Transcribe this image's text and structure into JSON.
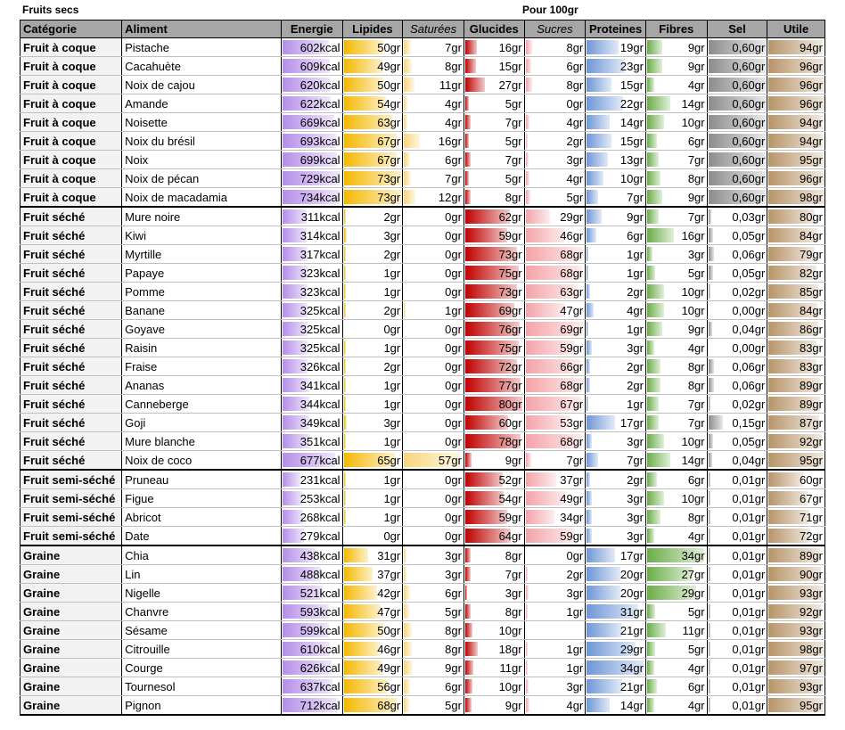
{
  "title": "Fruits secs",
  "subtitle": "Pour 100gr",
  "headers": [
    {
      "label": "Catégorie",
      "italic": false,
      "align": "left"
    },
    {
      "label": "Aliment",
      "italic": false,
      "align": "left"
    },
    {
      "label": "Energie",
      "italic": false,
      "align": "center"
    },
    {
      "label": "Lipides",
      "italic": false,
      "align": "center"
    },
    {
      "label": "Saturées",
      "italic": true,
      "align": "center"
    },
    {
      "label": "Glucides",
      "italic": false,
      "align": "center"
    },
    {
      "label": "Sucres",
      "italic": true,
      "align": "center"
    },
    {
      "label": "Proteines",
      "italic": false,
      "align": "center"
    },
    {
      "label": "Fibres",
      "italic": false,
      "align": "center"
    },
    {
      "label": "Sel",
      "italic": false,
      "align": "center"
    },
    {
      "label": "Utile",
      "italic": false,
      "align": "center"
    }
  ],
  "bar_colors": [
    "#b48ee9",
    "#f5b800",
    "#f8d678",
    "#c00000",
    "#f4a3a8",
    "#6e96d6",
    "#6aad47",
    "#8c8c8c",
    "#b79469"
  ],
  "bar_max": [
    734,
    73,
    57,
    80,
    69,
    34,
    34,
    0.6,
    98
  ],
  "rows": [
    [
      "Fruit à coque",
      "Pistache",
      "602kcal",
      "50gr",
      "7gr",
      "16gr",
      "8gr",
      "19gr",
      "9gr",
      "0,60gr",
      "94gr"
    ],
    [
      "Fruit à coque",
      "Cacahuète",
      "609kcal",
      "49gr",
      "8gr",
      "15gr",
      "6gr",
      "23gr",
      "9gr",
      "0,60gr",
      "96gr"
    ],
    [
      "Fruit à coque",
      "Noix de cajou",
      "620kcal",
      "50gr",
      "11gr",
      "27gr",
      "8gr",
      "15gr",
      "4gr",
      "0,60gr",
      "96gr"
    ],
    [
      "Fruit à coque",
      "Amande",
      "622kcal",
      "54gr",
      "4gr",
      "5gr",
      "0gr",
      "22gr",
      "14gr",
      "0,60gr",
      "96gr"
    ],
    [
      "Fruit à coque",
      "Noisette",
      "669kcal",
      "63gr",
      "4gr",
      "7gr",
      "4gr",
      "14gr",
      "10gr",
      "0,60gr",
      "94gr"
    ],
    [
      "Fruit à coque",
      "Noix du brésil",
      "693kcal",
      "67gr",
      "16gr",
      "5gr",
      "2gr",
      "15gr",
      "6gr",
      "0,60gr",
      "94gr"
    ],
    [
      "Fruit à coque",
      "Noix",
      "699kcal",
      "67gr",
      "6gr",
      "7gr",
      "3gr",
      "13gr",
      "7gr",
      "0,60gr",
      "95gr"
    ],
    [
      "Fruit à coque",
      "Noix de pécan",
      "729kcal",
      "73gr",
      "7gr",
      "5gr",
      "4gr",
      "10gr",
      "8gr",
      "0,60gr",
      "96gr"
    ],
    [
      "Fruit à coque",
      "Noix de macadamia",
      "734kcal",
      "73gr",
      "12gr",
      "8gr",
      "5gr",
      "7gr",
      "9gr",
      "0,60gr",
      "98gr"
    ],
    [
      "Fruit séché",
      "Mure noire",
      "311kcal",
      "2gr",
      "0gr",
      "62gr",
      "29gr",
      "9gr",
      "7gr",
      "0,03gr",
      "80gr"
    ],
    [
      "Fruit séché",
      "Kiwi",
      "314kcal",
      "3gr",
      "0gr",
      "59gr",
      "46gr",
      "6gr",
      "16gr",
      "0,05gr",
      "84gr"
    ],
    [
      "Fruit séché",
      "Myrtille",
      "317kcal",
      "2gr",
      "0gr",
      "73gr",
      "68gr",
      "1gr",
      "3gr",
      "0,06gr",
      "79gr"
    ],
    [
      "Fruit séché",
      "Papaye",
      "323kcal",
      "1gr",
      "0gr",
      "75gr",
      "68gr",
      "1gr",
      "5gr",
      "0,05gr",
      "82gr"
    ],
    [
      "Fruit séché",
      "Pomme",
      "323kcal",
      "1gr",
      "0gr",
      "73gr",
      "63gr",
      "2gr",
      "10gr",
      "0,02gr",
      "85gr"
    ],
    [
      "Fruit séché",
      "Banane",
      "325kcal",
      "2gr",
      "1gr",
      "69gr",
      "47gr",
      "4gr",
      "10gr",
      "0,00gr",
      "84gr"
    ],
    [
      "Fruit séché",
      "Goyave",
      "325kcal",
      "0gr",
      "0gr",
      "76gr",
      "69gr",
      "1gr",
      "9gr",
      "0,04gr",
      "86gr"
    ],
    [
      "Fruit séché",
      "Raisin",
      "325kcal",
      "1gr",
      "0gr",
      "75gr",
      "59gr",
      "3gr",
      "4gr",
      "0,00gr",
      "83gr"
    ],
    [
      "Fruit séché",
      "Fraise",
      "326kcal",
      "2gr",
      "0gr",
      "72gr",
      "66gr",
      "2gr",
      "8gr",
      "0,06gr",
      "83gr"
    ],
    [
      "Fruit séché",
      "Ananas",
      "341kcal",
      "1gr",
      "0gr",
      "77gr",
      "68gr",
      "2gr",
      "8gr",
      "0,06gr",
      "89gr"
    ],
    [
      "Fruit séché",
      "Canneberge",
      "344kcal",
      "1gr",
      "0gr",
      "80gr",
      "67gr",
      "1gr",
      "7gr",
      "0,02gr",
      "89gr"
    ],
    [
      "Fruit séché",
      "Goji",
      "349kcal",
      "3gr",
      "0gr",
      "60gr",
      "53gr",
      "17gr",
      "7gr",
      "0,15gr",
      "87gr"
    ],
    [
      "Fruit séché",
      "Mure blanche",
      "351kcal",
      "1gr",
      "0gr",
      "78gr",
      "68gr",
      "3gr",
      "10gr",
      "0,05gr",
      "92gr"
    ],
    [
      "Fruit séché",
      "Noix de coco",
      "677kcal",
      "65gr",
      "57gr",
      "9gr",
      "7gr",
      "7gr",
      "14gr",
      "0,04gr",
      "95gr"
    ],
    [
      "Fruit semi-séché",
      "Pruneau",
      "231kcal",
      "1gr",
      "0gr",
      "52gr",
      "37gr",
      "2gr",
      "6gr",
      "0,01gr",
      "60gr"
    ],
    [
      "Fruit semi-séché",
      "Figue",
      "253kcal",
      "1gr",
      "0gr",
      "54gr",
      "49gr",
      "3gr",
      "10gr",
      "0,01gr",
      "67gr"
    ],
    [
      "Fruit semi-séché",
      "Abricot",
      "268kcal",
      "1gr",
      "0gr",
      "59gr",
      "34gr",
      "3gr",
      "8gr",
      "0,01gr",
      "71gr"
    ],
    [
      "Fruit semi-séché",
      "Date",
      "279kcal",
      "0gr",
      "0gr",
      "64gr",
      "59gr",
      "3gr",
      "4gr",
      "0,01gr",
      "72gr"
    ],
    [
      "Graine",
      "Chia",
      "438kcal",
      "31gr",
      "3gr",
      "8gr",
      "0gr",
      "17gr",
      "34gr",
      "0,01gr",
      "89gr"
    ],
    [
      "Graine",
      "Lin",
      "488kcal",
      "37gr",
      "3gr",
      "7gr",
      "2gr",
      "20gr",
      "27gr",
      "0,01gr",
      "90gr"
    ],
    [
      "Graine",
      "Nigelle",
      "521kcal",
      "42gr",
      "6gr",
      "3gr",
      "3gr",
      "20gr",
      "29gr",
      "0,01gr",
      "93gr"
    ],
    [
      "Graine",
      "Chanvre",
      "593kcal",
      "47gr",
      "5gr",
      "8gr",
      "1gr",
      "31gr",
      "5gr",
      "0,01gr",
      "92gr"
    ],
    [
      "Graine",
      "Sésame",
      "599kcal",
      "50gr",
      "8gr",
      "10gr",
      "",
      "21gr",
      "11gr",
      "0,01gr",
      "93gr"
    ],
    [
      "Graine",
      "Citrouille",
      "610kcal",
      "46gr",
      "8gr",
      "18gr",
      "1gr",
      "29gr",
      "5gr",
      "0,01gr",
      "98gr"
    ],
    [
      "Graine",
      "Courge",
      "626kcal",
      "49gr",
      "9gr",
      "11gr",
      "1gr",
      "34gr",
      "4gr",
      "0,01gr",
      "97gr"
    ],
    [
      "Graine",
      "Tournesol",
      "637kcal",
      "56gr",
      "6gr",
      "10gr",
      "3gr",
      "21gr",
      "6gr",
      "0,01gr",
      "93gr"
    ],
    [
      "Graine",
      "Pignon",
      "712kcal",
      "68gr",
      "5gr",
      "9gr",
      "4gr",
      "14gr",
      "4gr",
      "0,01gr",
      "95gr"
    ]
  ]
}
